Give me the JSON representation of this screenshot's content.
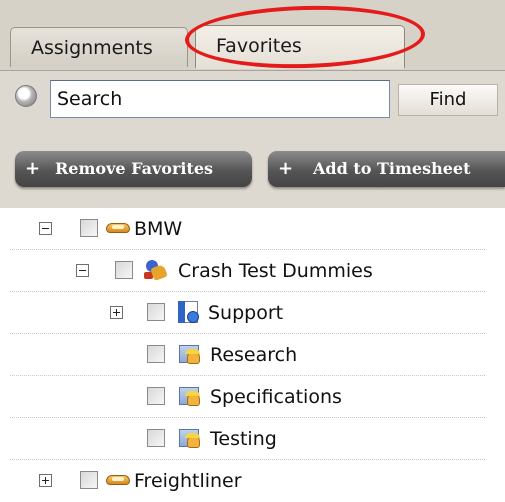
{
  "tabs": [
    {
      "label": "Assignments",
      "active": false
    },
    {
      "label": "Favorites",
      "active": true
    }
  ],
  "search": {
    "value": "Search",
    "find_label": "Find"
  },
  "toolbar": {
    "remove_label": "Remove Favorites",
    "add_label": "Add to Timesheet",
    "plus": "+"
  },
  "colors": {
    "highlight_ellipse": "#e51b1b",
    "panel_bg": "#ddd9d0",
    "button_dark": "#555555"
  },
  "tree": {
    "items": [
      {
        "label": "BMW",
        "icon": "handshake-icon",
        "expander": "collapse"
      },
      {
        "label": "Crash Test Dummies",
        "icon": "project-icon",
        "expander": "collapse"
      },
      {
        "label": "Support",
        "icon": "support-icon",
        "expander": "expand"
      },
      {
        "label": "Research",
        "icon": "task-icon"
      },
      {
        "label": "Specifications",
        "icon": "task-icon"
      },
      {
        "label": "Testing",
        "icon": "task-icon"
      },
      {
        "label": "Freightliner",
        "icon": "handshake-icon",
        "expander": "expand"
      }
    ]
  }
}
